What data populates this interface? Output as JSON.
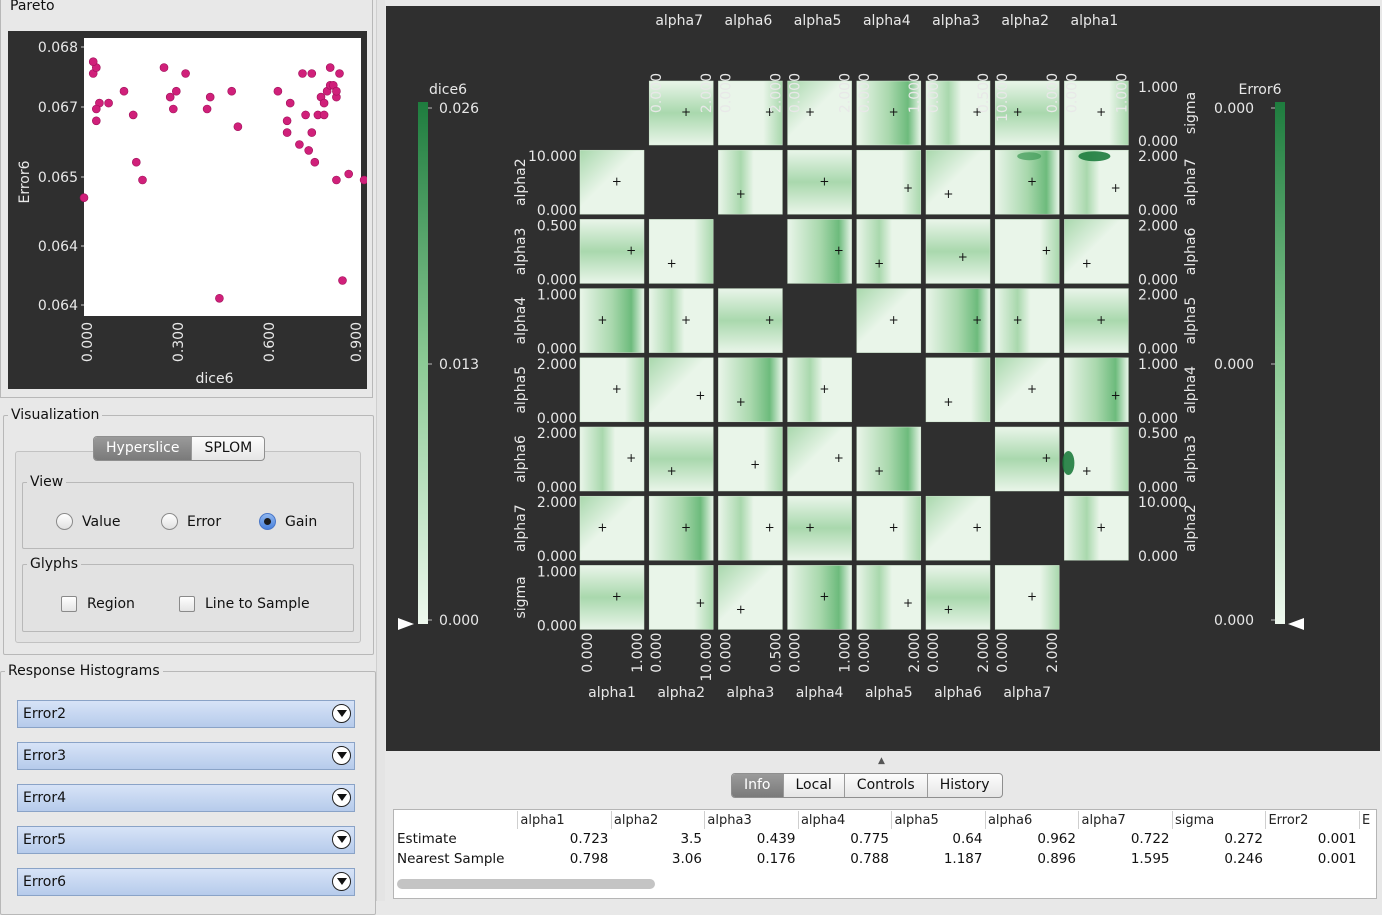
{
  "pareto": {
    "title": "Pareto",
    "xlabel": "dice6",
    "ylabel": "Error6",
    "x_ticks": [
      "0.000",
      "0.300",
      "0.600",
      "0.900"
    ],
    "y_ticks": [
      "0.068",
      "0.067",
      "0.065",
      "0.064",
      "0.064"
    ]
  },
  "visualization": {
    "title": "Visualization",
    "modes": [
      "Hyperslice",
      "SPLOM"
    ],
    "active_mode": "Hyperslice",
    "view_title": "View",
    "view_options": [
      "Value",
      "Error",
      "Gain"
    ],
    "view_selected": "Gain",
    "glyphs_title": "Glyphs",
    "glyph_options": [
      "Region",
      "Line to Sample"
    ]
  },
  "histograms": {
    "title": "Response Histograms",
    "items": [
      "Error2",
      "Error3",
      "Error4",
      "Error5",
      "Error6"
    ]
  },
  "hyperslice": {
    "vars": [
      "alpha1",
      "alpha2",
      "alpha3",
      "alpha4",
      "alpha5",
      "alpha6",
      "alpha7",
      "sigma"
    ],
    "top_vars": [
      "alpha7",
      "alpha6",
      "alpha5",
      "alpha4",
      "alpha3",
      "alpha2",
      "alpha1"
    ],
    "top_ranges": [
      [
        "0.000",
        "2.000"
      ],
      [
        "0.000",
        "2.000"
      ],
      [
        "0.000",
        "2.000"
      ],
      [
        "0.000",
        "1.000"
      ],
      [
        "0.000",
        "0.500"
      ],
      [
        "10.000",
        "0.000"
      ],
      [
        "0.000",
        "1.000"
      ]
    ],
    "bottom_ranges": [
      [
        "0.000",
        "1.000"
      ],
      [
        "0.000",
        "10.000"
      ],
      [
        "0.000",
        "0.500"
      ],
      [
        "0.000",
        "1.000"
      ],
      [
        "0.000",
        "2.000"
      ],
      [
        "0.000",
        "2.000"
      ],
      [
        "0.000",
        "2.000"
      ]
    ],
    "left_vars": [
      "alpha2",
      "alpha3",
      "alpha4",
      "alpha5",
      "alpha6",
      "alpha7",
      "sigma"
    ],
    "left_ranges": [
      [
        "10.000",
        "0.000"
      ],
      [
        "0.500",
        "0.000"
      ],
      [
        "1.000",
        "0.000"
      ],
      [
        "2.000",
        "0.000"
      ],
      [
        "2.000",
        "0.000"
      ],
      [
        "2.000",
        "0.000"
      ],
      [
        "1.000",
        "0.000"
      ]
    ],
    "right_vars": [
      "sigma",
      "alpha7",
      "alpha6",
      "alpha5",
      "alpha4",
      "alpha3",
      "alpha2"
    ],
    "right_ranges": [
      [
        "1.000",
        "0.000"
      ],
      [
        "2.000",
        "0.000"
      ],
      [
        "2.000",
        "0.000"
      ],
      [
        "2.000",
        "0.000"
      ],
      [
        "1.000",
        "0.000"
      ],
      [
        "0.500",
        "0.000"
      ],
      [
        "10.000",
        "0.000"
      ]
    ],
    "colorbar_left": {
      "title": "dice6",
      "ticks": [
        "0.026",
        "0.013",
        "0.000"
      ]
    },
    "colorbar_right": {
      "title": "Error6",
      "ticks": [
        "0.000",
        "0.000",
        "0.000"
      ]
    },
    "colors": {
      "light": "#e9f5e9",
      "mid": "#a9d8ad",
      "dark": "#1e7c3e"
    }
  },
  "tabs": [
    "Info",
    "Local",
    "Controls",
    "History"
  ],
  "active_tab": "Info",
  "info_table": {
    "columns": [
      "",
      "alpha1",
      "alpha2",
      "alpha3",
      "alpha4",
      "alpha5",
      "alpha6",
      "alpha7",
      "sigma",
      "Error2",
      "E"
    ],
    "rows": [
      {
        "label": "Estimate",
        "values": [
          "0.723",
          "3.5",
          "0.439",
          "0.775",
          "0.64",
          "0.962",
          "0.722",
          "0.272",
          "0.001"
        ]
      },
      {
        "label": "Nearest Sample",
        "values": [
          "0.798",
          "3.06",
          "0.176",
          "0.788",
          "1.187",
          "0.896",
          "1.595",
          "0.246",
          "0.001"
        ]
      }
    ]
  },
  "chart_data": {
    "type": "scatter",
    "title": "Pareto",
    "xlabel": "dice6",
    "ylabel": "Error6",
    "xlim": [
      0.0,
      0.9
    ],
    "ylim": [
      0.0638,
      0.0685
    ],
    "x": [
      0.0,
      0.03,
      0.04,
      0.03,
      0.05,
      0.04,
      0.04,
      0.08,
      0.13,
      0.16,
      0.17,
      0.19,
      0.26,
      0.28,
      0.29,
      0.3,
      0.33,
      0.4,
      0.41,
      0.44,
      0.48,
      0.5,
      0.63,
      0.66,
      0.67,
      0.7,
      0.71,
      0.72,
      0.74,
      0.74,
      0.76,
      0.77,
      0.78,
      0.78,
      0.79,
      0.8,
      0.8,
      0.81,
      0.82,
      0.82,
      0.83,
      0.82,
      0.84,
      0.86,
      0.91,
      0.66,
      0.75,
      0.73
    ],
    "y": [
      0.0658,
      0.0679,
      0.068,
      0.0681,
      0.0674,
      0.0673,
      0.0671,
      0.0674,
      0.0676,
      0.0672,
      0.0664,
      0.0661,
      0.068,
      0.0675,
      0.0673,
      0.0676,
      0.0679,
      0.0673,
      0.0675,
      0.0641,
      0.0676,
      0.067,
      0.0676,
      0.0671,
      0.0674,
      0.0667,
      0.0679,
      0.0672,
      0.0679,
      0.0669,
      0.0672,
      0.0675,
      0.0672,
      0.0674,
      0.0676,
      0.068,
      0.0677,
      0.0677,
      0.0675,
      0.0661,
      0.0679,
      0.0676,
      0.0644,
      0.0662,
      0.0661,
      0.0669,
      0.0664,
      0.0666
    ]
  }
}
